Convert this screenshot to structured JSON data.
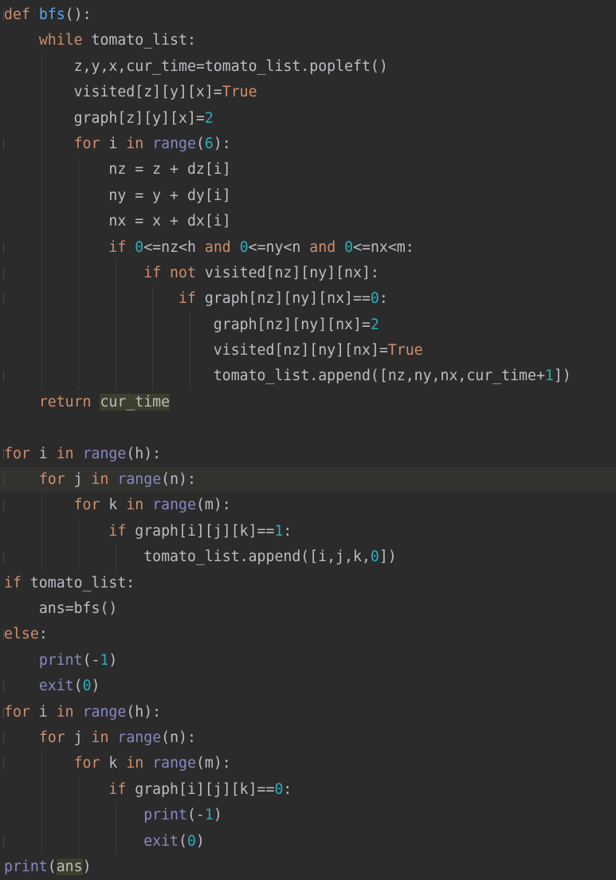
{
  "editor": {
    "lines": [
      {
        "i": 0,
        "t": [
          [
            "kw",
            "def "
          ],
          [
            "fn",
            "bfs"
          ],
          [
            "",
            "():"
          ]
        ],
        "fold": true
      },
      {
        "i": 1,
        "t": [
          [
            "kw",
            "while"
          ],
          [
            "",
            " tomato_list:"
          ]
        ]
      },
      {
        "i": 2,
        "t": [
          [
            "",
            "z,y,x,cur_time=tomato_list.popleft()"
          ]
        ]
      },
      {
        "i": 2,
        "t": [
          [
            "",
            "visited[z][y][x]="
          ],
          [
            "kw",
            "True"
          ]
        ]
      },
      {
        "i": 2,
        "t": [
          [
            "",
            "graph[z][y][x]="
          ],
          [
            "num",
            "2"
          ]
        ]
      },
      {
        "i": 2,
        "t": [
          [
            "kw",
            "for"
          ],
          [
            "",
            " i "
          ],
          [
            "kw",
            "in"
          ],
          [
            "",
            " "
          ],
          [
            "bi",
            "range"
          ],
          [
            "",
            "("
          ],
          [
            "num",
            "6"
          ],
          [
            "",
            "):"
          ]
        ],
        "fold": true
      },
      {
        "i": 3,
        "t": [
          [
            "",
            "nz = z + dz[i]"
          ]
        ]
      },
      {
        "i": 3,
        "t": [
          [
            "",
            "ny = y + dy[i]"
          ]
        ]
      },
      {
        "i": 3,
        "t": [
          [
            "",
            "nx = x + dx[i]"
          ]
        ]
      },
      {
        "i": 3,
        "t": [
          [
            "kw",
            "if "
          ],
          [
            "num",
            "0"
          ],
          [
            "",
            "<=nz<h "
          ],
          [
            "kw",
            "and "
          ],
          [
            "num",
            "0"
          ],
          [
            "",
            "<=ny<n "
          ],
          [
            "kw",
            "and "
          ],
          [
            "num",
            "0"
          ],
          [
            "",
            "<=nx<m:"
          ]
        ],
        "fold": true
      },
      {
        "i": 4,
        "t": [
          [
            "kw",
            "if not"
          ],
          [
            "",
            " visited[nz][ny][nx]:"
          ]
        ],
        "fold": true
      },
      {
        "i": 5,
        "t": [
          [
            "kw",
            "if"
          ],
          [
            "",
            " graph[nz][ny][nx]=="
          ],
          [
            "num",
            "0"
          ],
          [
            "",
            ":"
          ]
        ],
        "fold": true
      },
      {
        "i": 6,
        "t": [
          [
            "",
            "graph[nz][ny][nx]="
          ],
          [
            "num",
            "2"
          ]
        ]
      },
      {
        "i": 6,
        "t": [
          [
            "",
            "visited[nz][ny][nx]="
          ],
          [
            "kw",
            "True"
          ]
        ]
      },
      {
        "i": 6,
        "t": [
          [
            "",
            "tomato_list.append([nz,ny,nx,cur_time+"
          ],
          [
            "num",
            "1"
          ],
          [
            "",
            "])"
          ]
        ],
        "fold": true
      },
      {
        "i": 1,
        "t": [
          [
            "kw",
            "return "
          ],
          [
            "hl",
            "cur_time"
          ]
        ]
      },
      {
        "i": 0,
        "t": []
      },
      {
        "i": 0,
        "t": [
          [
            "kw",
            "for"
          ],
          [
            "",
            " i "
          ],
          [
            "kw",
            "in"
          ],
          [
            "",
            " "
          ],
          [
            "bi",
            "range"
          ],
          [
            "",
            "(h):"
          ]
        ],
        "fold": true
      },
      {
        "i": 1,
        "t": [
          [
            "kw",
            "for"
          ],
          [
            "",
            " j "
          ],
          [
            "kw",
            "in"
          ],
          [
            "",
            " "
          ],
          [
            "bi",
            "range"
          ],
          [
            "",
            "(n):"
          ]
        ],
        "fold": true,
        "caret": true
      },
      {
        "i": 2,
        "t": [
          [
            "kw",
            "for"
          ],
          [
            "",
            " k "
          ],
          [
            "kw",
            "in"
          ],
          [
            "",
            " "
          ],
          [
            "bi",
            "range"
          ],
          [
            "",
            "(m):"
          ]
        ],
        "fold": true
      },
      {
        "i": 3,
        "t": [
          [
            "kw",
            "if"
          ],
          [
            "",
            " graph[i][j][k]=="
          ],
          [
            "num",
            "1"
          ],
          [
            "",
            ":"
          ]
        ]
      },
      {
        "i": 4,
        "t": [
          [
            "",
            "tomato_list.append([i,j,k,"
          ],
          [
            "num",
            "0"
          ],
          [
            "",
            "])"
          ]
        ],
        "fold": true
      },
      {
        "i": 0,
        "t": [
          [
            "kw",
            "if"
          ],
          [
            "",
            " tomato_list:"
          ]
        ]
      },
      {
        "i": 1,
        "t": [
          [
            "",
            "ans=bfs()"
          ]
        ]
      },
      {
        "i": 0,
        "t": [
          [
            "kw",
            "else"
          ],
          [
            "",
            ":"
          ]
        ],
        "fold": true
      },
      {
        "i": 1,
        "t": [
          [
            "bi",
            "print"
          ],
          [
            "",
            "(-"
          ],
          [
            "num",
            "1"
          ],
          [
            "",
            ")"
          ]
        ]
      },
      {
        "i": 1,
        "t": [
          [
            "bi",
            "exit"
          ],
          [
            "",
            "("
          ],
          [
            "num",
            "0"
          ],
          [
            "",
            ")"
          ]
        ],
        "fold": true
      },
      {
        "i": 0,
        "t": [
          [
            "kw",
            "for"
          ],
          [
            "",
            " i "
          ],
          [
            "kw",
            "in"
          ],
          [
            "",
            " "
          ],
          [
            "bi",
            "range"
          ],
          [
            "",
            "(h):"
          ]
        ],
        "fold": true
      },
      {
        "i": 1,
        "t": [
          [
            "kw",
            "for"
          ],
          [
            "",
            " j "
          ],
          [
            "kw",
            "in"
          ],
          [
            "",
            " "
          ],
          [
            "bi",
            "range"
          ],
          [
            "",
            "(n):"
          ]
        ],
        "fold": true
      },
      {
        "i": 2,
        "t": [
          [
            "kw",
            "for"
          ],
          [
            "",
            " k "
          ],
          [
            "kw",
            "in"
          ],
          [
            "",
            " "
          ],
          [
            "bi",
            "range"
          ],
          [
            "",
            "(m):"
          ]
        ],
        "fold": true
      },
      {
        "i": 3,
        "t": [
          [
            "kw",
            "if"
          ],
          [
            "",
            " graph[i][j][k]=="
          ],
          [
            "num",
            "0"
          ],
          [
            "",
            ":"
          ]
        ]
      },
      {
        "i": 4,
        "t": [
          [
            "bi",
            "print"
          ],
          [
            "",
            "(-"
          ],
          [
            "num",
            "1"
          ],
          [
            "",
            ")"
          ]
        ]
      },
      {
        "i": 4,
        "t": [
          [
            "bi",
            "exit"
          ],
          [
            "",
            "("
          ],
          [
            "num",
            "0"
          ],
          [
            "",
            ")"
          ]
        ],
        "fold": true
      },
      {
        "i": 0,
        "t": [
          [
            "bi",
            "print"
          ],
          [
            "",
            "("
          ],
          [
            "hl",
            "ans"
          ],
          [
            "",
            ")"
          ]
        ]
      }
    ]
  },
  "colors": {
    "background": "#2b2b2b",
    "keyword": "#cf8e6d",
    "number": "#2aacb8",
    "function": "#56a8f5",
    "builtin": "#8888c6",
    "text": "#bcbec4"
  }
}
